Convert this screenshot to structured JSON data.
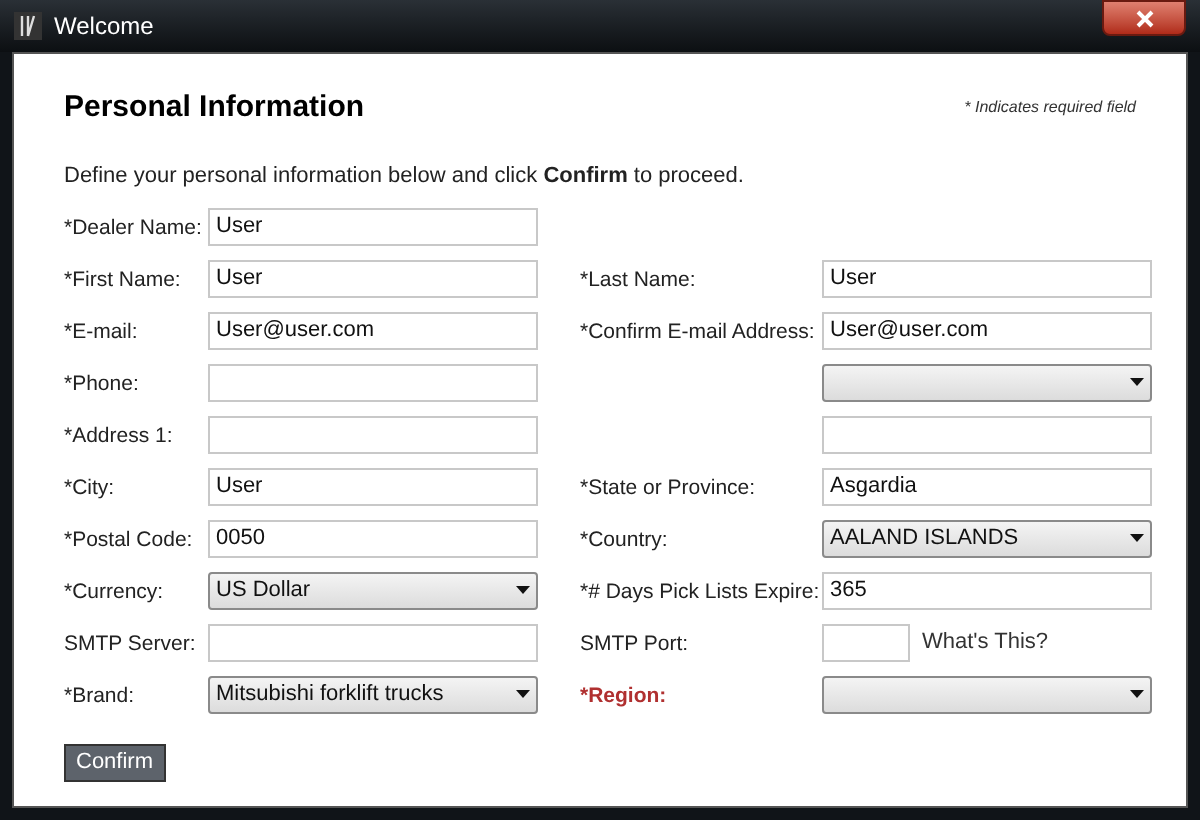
{
  "window": {
    "title": "Welcome"
  },
  "heading": "Personal Information",
  "required_note": "* Indicates required field",
  "intro": "Define your personal information below and click **Confirm** to proceed.",
  "rows": [
    [
      {
        "kind": "text",
        "label": "*Dealer Name:",
        "highlighted": false,
        "value": "User"
      }
    ],
    [
      {
        "kind": "text",
        "label": "*First Name:",
        "highlighted": false,
        "value": "User"
      },
      {
        "kind": "text",
        "label": "*Last Name:",
        "highlighted": false,
        "value": "User"
      }
    ],
    [
      {
        "kind": "text",
        "label": "*E-mail:",
        "highlighted": false,
        "value": "User@user.com"
      },
      {
        "kind": "text",
        "label": "*Confirm E-mail Address:",
        "highlighted": false,
        "value": "User@user.com"
      }
    ],
    [
      {
        "kind": "text",
        "label": "*Phone:",
        "highlighted": false
      },
      {
        "kind": "select"
      }
    ],
    [
      {
        "kind": "text",
        "label": "*Address 1:",
        "highlighted": false
      },
      {
        "kind": "text"
      }
    ],
    [
      {
        "kind": "text",
        "label": "*City:",
        "highlighted": false,
        "value": "User"
      },
      {
        "kind": "text",
        "label": "*State or Province:",
        "highlighted": false,
        "value": "Asgardia"
      }
    ],
    [
      {
        "kind": "text",
        "label": "*Postal Code:",
        "highlighted": false,
        "value": "0050"
      },
      {
        "kind": "select",
        "label": "*Country:",
        "highlighted": false,
        "value": "AALAND ISLANDS"
      }
    ],
    [
      {
        "kind": "select",
        "label": "*Currency:",
        "highlighted": false,
        "value": "US Dollar"
      },
      {
        "kind": "text",
        "label": "*# Days Pick Lists Expire:",
        "highlighted": false,
        "value": "365"
      }
    ],
    [
      {
        "kind": "text",
        "label": "SMTP Server:",
        "highlighted": false
      },
      {
        "kind": "short",
        "label": "SMTP Port:",
        "highlighted": false,
        "link": "What's This?"
      }
    ],
    [
      {
        "kind": "select",
        "label": "*Brand:",
        "highlighted": false,
        "value": "Mitsubishi forklift trucks"
      },
      {
        "kind": "select",
        "label": "*Region:",
        "highlighted": true
      }
    ]
  ],
  "confirm_button": "Confirm"
}
